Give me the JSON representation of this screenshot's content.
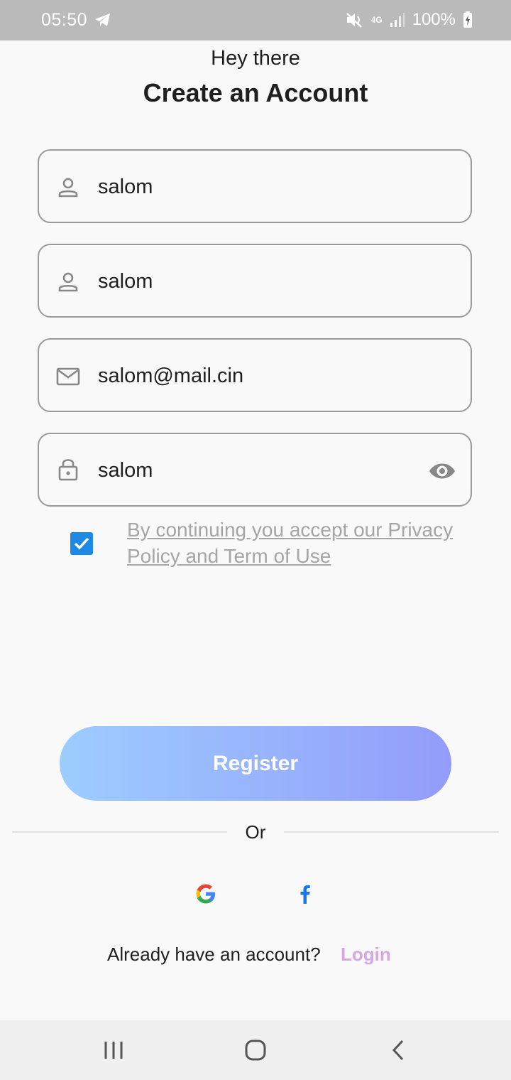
{
  "status_bar": {
    "time": "05:50",
    "battery": "100%",
    "network": "4G",
    "icons": [
      "telegram-icon",
      "mute-icon",
      "signal-icon",
      "battery-charging-icon"
    ]
  },
  "header": {
    "greeting": "Hey there",
    "title": "Create an Account"
  },
  "form": {
    "first_name": {
      "value": "salom",
      "icon": "person-icon"
    },
    "last_name": {
      "value": "salom",
      "icon": "person-icon"
    },
    "email": {
      "value": "salom@mail.cin",
      "icon": "mail-icon"
    },
    "password": {
      "value": "salom",
      "icon": "lock-icon",
      "toggle_icon": "eye-icon"
    },
    "terms": {
      "checked": true,
      "label": "By continuing you accept our Privacy Policy and Term of Use"
    }
  },
  "actions": {
    "register_label": "Register",
    "or_label": "Or",
    "social": [
      "google-icon",
      "facebook-icon"
    ],
    "already_label": "Already have an account?",
    "login_label": "Login"
  },
  "colors": {
    "accent": "#1e88e5",
    "gradient_start": "#9dcdff",
    "gradient_end": "#939cfa",
    "login_link": "#d6a6e6",
    "status_bar": "#bababa"
  },
  "nav_bar": {
    "icons": [
      "recents-icon",
      "home-icon",
      "back-icon"
    ]
  }
}
